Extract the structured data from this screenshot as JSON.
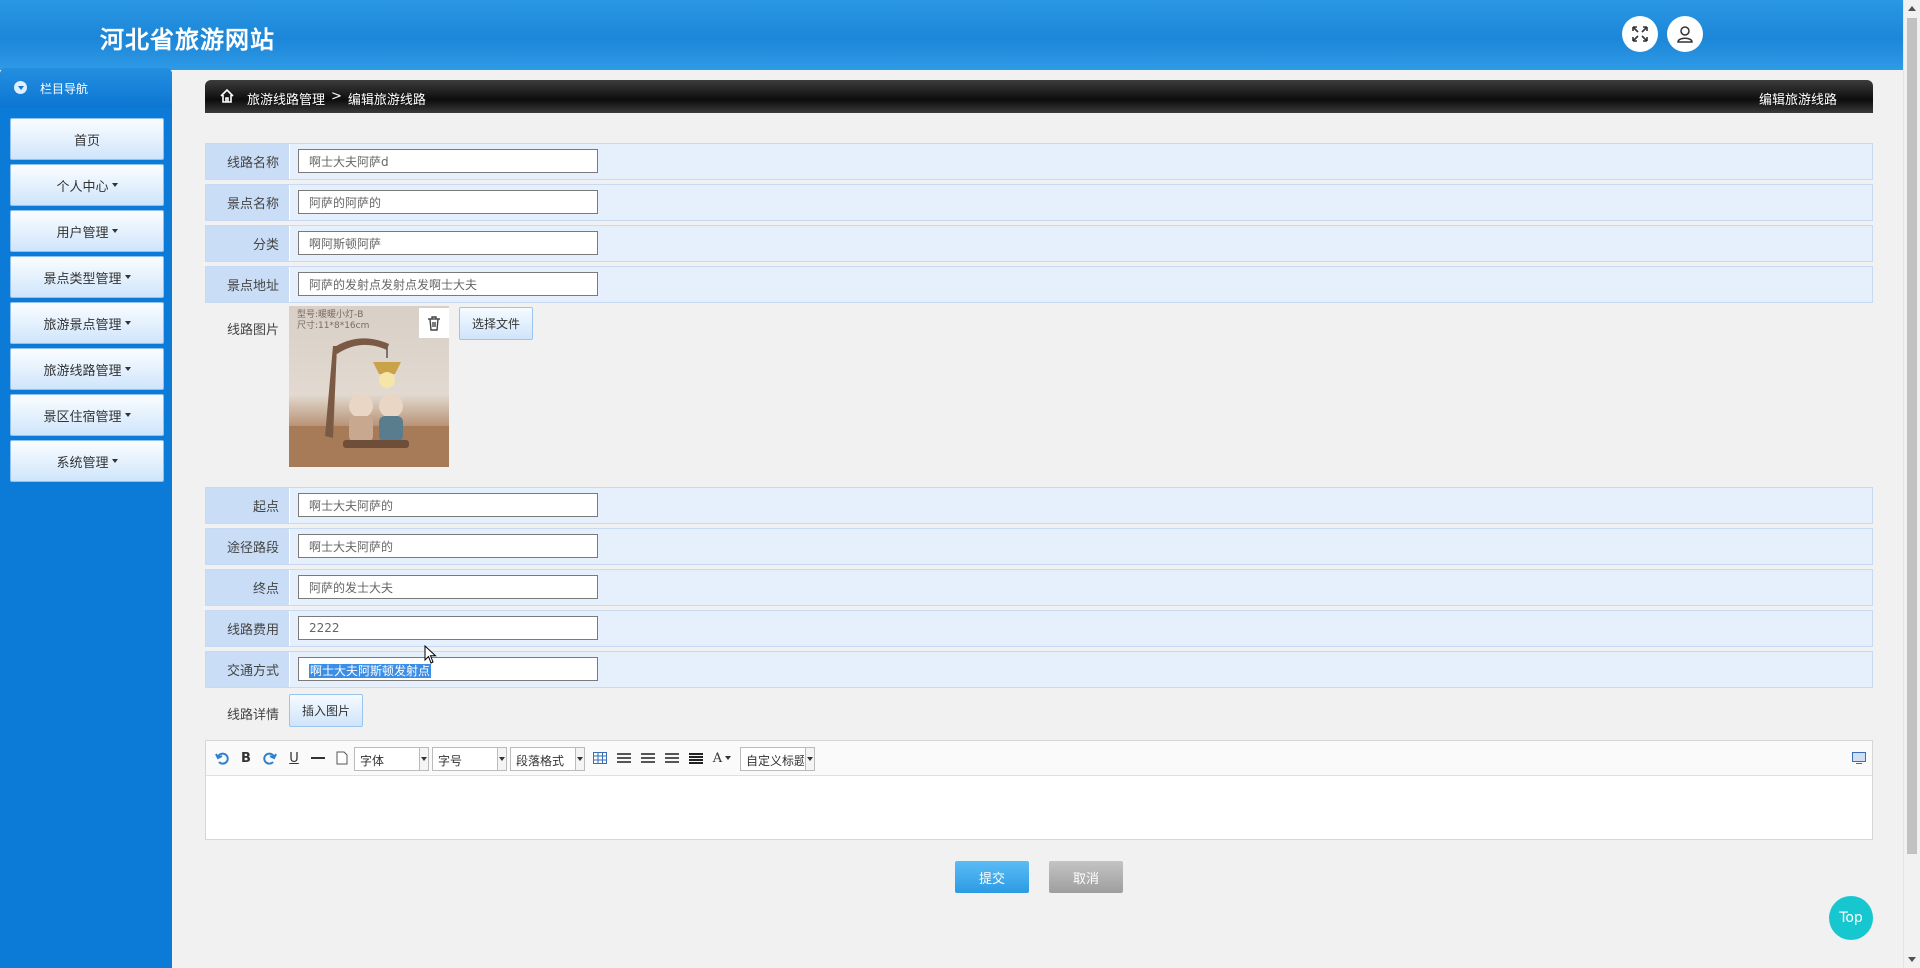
{
  "header": {
    "site_title": "河北省旅游网站",
    "fullscreen_icon": "expand-icon",
    "user_icon": "user-icon"
  },
  "sidebar": {
    "heading": "栏目导航",
    "items": [
      {
        "label": "首页",
        "has_caret": false
      },
      {
        "label": "个人中心",
        "has_caret": true
      },
      {
        "label": "用户管理",
        "has_caret": true
      },
      {
        "label": "景点类型管理",
        "has_caret": true
      },
      {
        "label": "旅游景点管理",
        "has_caret": true
      },
      {
        "label": "旅游线路管理",
        "has_caret": true
      },
      {
        "label": "景区住宿管理",
        "has_caret": true
      },
      {
        "label": "系统管理",
        "has_caret": true
      }
    ]
  },
  "breadcrumb": {
    "parent": "旅游线路管理",
    "separator": ">",
    "current": "编辑旅游线路",
    "right_title": "编辑旅游线路"
  },
  "form": {
    "route_name": {
      "label": "线路名称",
      "value": "啊士大夫阿萨d"
    },
    "spot_name": {
      "label": "景点名称",
      "value": "阿萨的阿萨的"
    },
    "category": {
      "label": "分类",
      "value": "啊阿斯顿阿萨"
    },
    "spot_address": {
      "label": "景点地址",
      "value": "阿萨的发射点发射点发啊士大夫"
    },
    "route_image": {
      "label": "线路图片",
      "stamp_line1": "型号:暖暖小灯-B",
      "stamp_line2": "尺寸:11*8*16cm",
      "choose_file": "选择文件"
    },
    "start": {
      "label": "起点",
      "value": "啊士大夫阿萨的"
    },
    "waypoints": {
      "label": "途径路段",
      "value": "啊士大夫阿萨的"
    },
    "end": {
      "label": "终点",
      "value": "阿萨的发士大夫"
    },
    "cost": {
      "label": "线路费用",
      "value": "2222"
    },
    "transport": {
      "label": "交通方式",
      "value": "啊士大夫阿斯顿发射点"
    },
    "details": {
      "label": "线路详情",
      "insert_image": "插入图片"
    }
  },
  "editor": {
    "bold": "B",
    "underline": "U",
    "font_select": "字体",
    "size_select": "字号",
    "paragraph_select": "段落格式",
    "font_color": "A",
    "custom_title_select": "自定义标题"
  },
  "actions": {
    "submit": "提交",
    "cancel": "取消",
    "top": "Top"
  },
  "colors": {
    "header_blue": "#1c86d8",
    "sidebar_blue": "#0c7bd8",
    "submit_blue": "#2b9be3",
    "top_teal": "#16c7cf"
  }
}
